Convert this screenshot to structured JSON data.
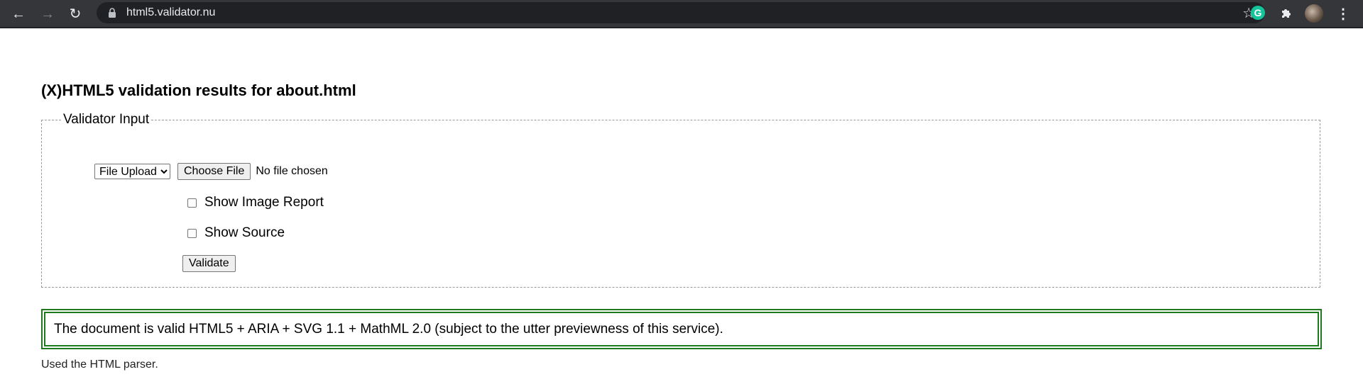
{
  "browser": {
    "url": "html5.validator.nu",
    "back_icon": "←",
    "forward_icon": "→",
    "reload_icon": "↻",
    "star_icon": "☆",
    "grammarly_label": "G",
    "extensions_icon": "puzzle",
    "menu_icon": "⋮"
  },
  "page": {
    "title": "(X)HTML5 validation results for about.html",
    "validator": {
      "legend": "Validator Input",
      "mode_options": [
        "File Upload"
      ],
      "mode_selected": "File Upload",
      "choose_file_label": "Choose File",
      "no_file_text": "No file chosen",
      "show_image_report_label": "Show Image Report",
      "show_source_label": "Show Source",
      "validate_label": "Validate"
    },
    "result_message": "The document is valid HTML5 + ARIA + SVG 1.1 + MathML 2.0 (subject to the utter previewness of this service).",
    "parser_note": "Used the HTML parser."
  },
  "colors": {
    "chrome_bg": "#35363a",
    "omnibox_bg": "#202124",
    "success_border": "#1f7a1f"
  }
}
